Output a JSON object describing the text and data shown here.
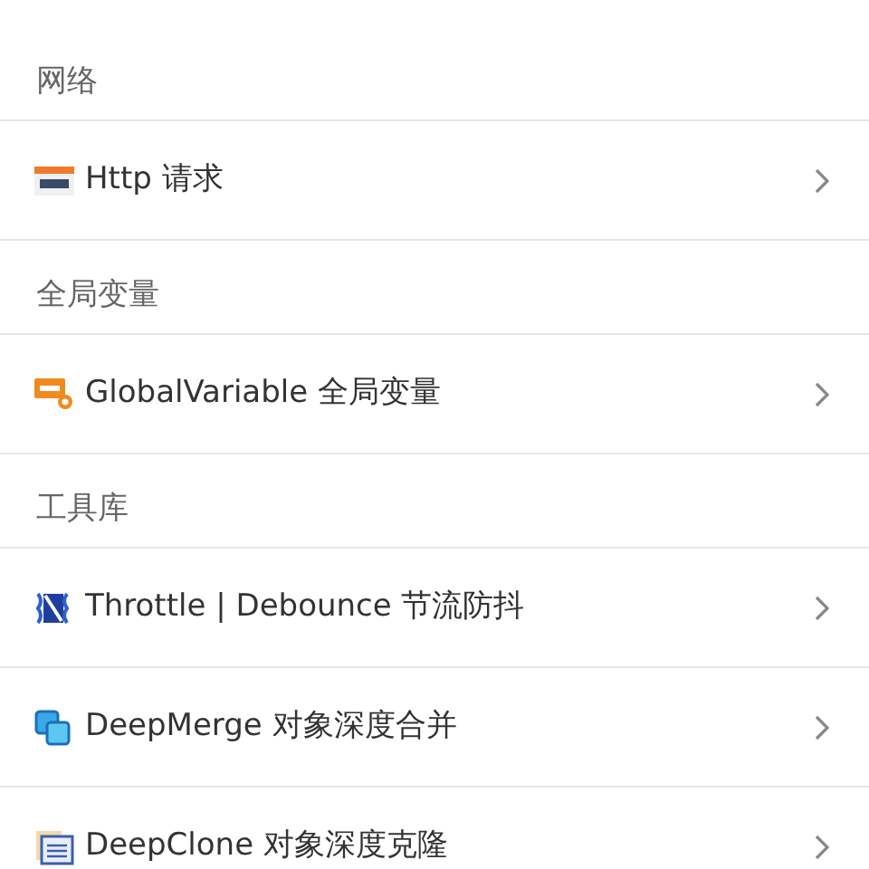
{
  "sections": [
    {
      "title": "网络",
      "items": [
        {
          "label": "Http 请求"
        }
      ]
    },
    {
      "title": "全局变量",
      "items": [
        {
          "label": "GlobalVariable 全局变量"
        }
      ]
    },
    {
      "title": "工具库",
      "items": [
        {
          "label": "Throttle | Debounce 节流防抖"
        },
        {
          "label": "DeepMerge 对象深度合并"
        },
        {
          "label": "DeepClone 对象深度克隆"
        }
      ]
    }
  ]
}
